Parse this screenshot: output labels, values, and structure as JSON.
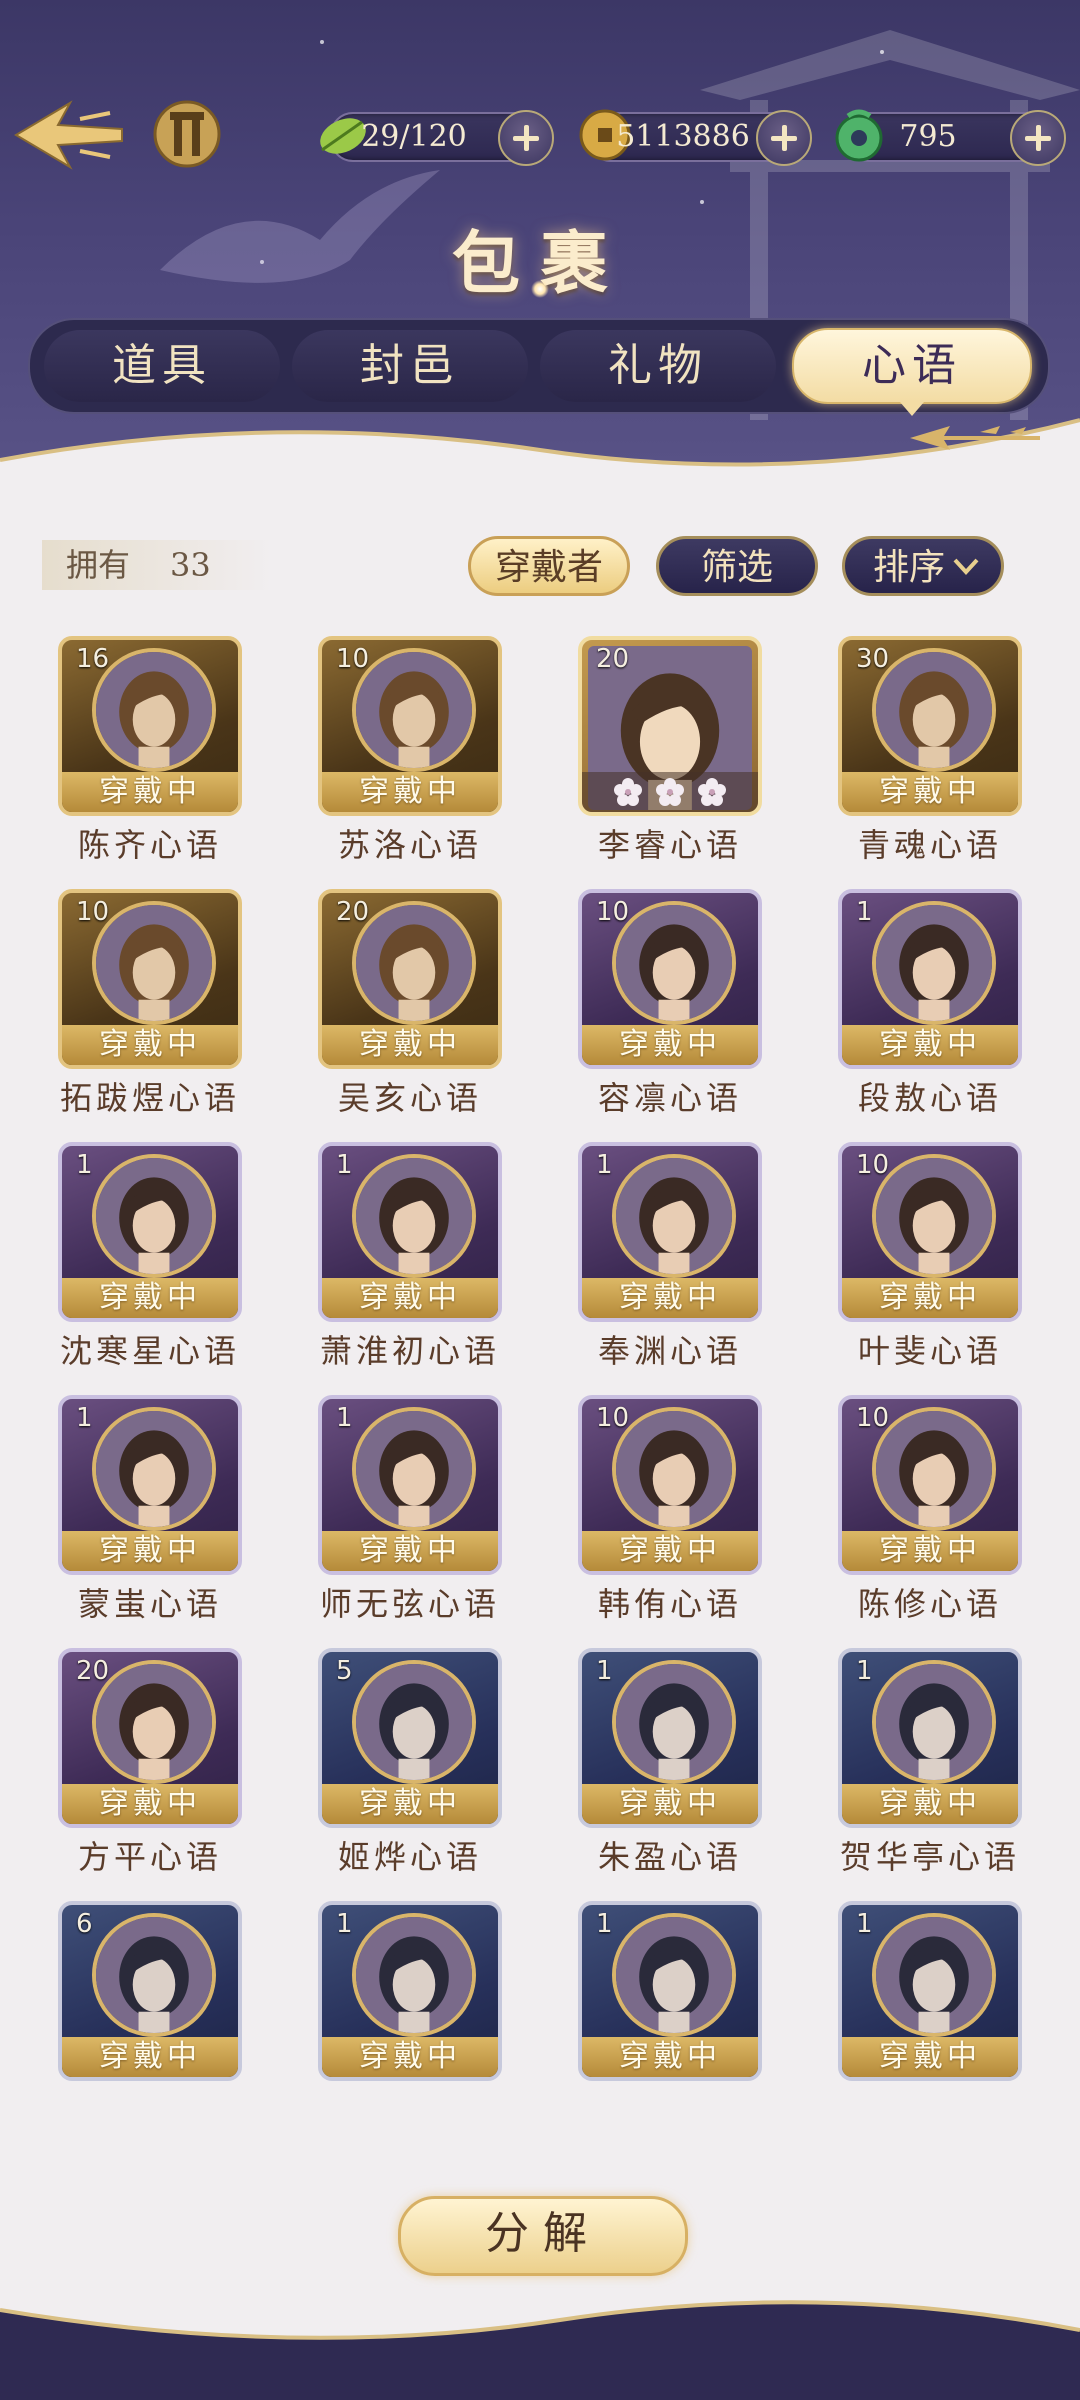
{
  "header": {
    "title": "包裹",
    "resources": [
      {
        "icon": "leaf-stamina-icon",
        "value": "29/120"
      },
      {
        "icon": "coin-icon",
        "value": "5113886"
      },
      {
        "icon": "jade-icon",
        "value": "795"
      }
    ]
  },
  "tabs": [
    {
      "label": "道具",
      "active": false
    },
    {
      "label": "封邑",
      "active": false
    },
    {
      "label": "礼物",
      "active": false
    },
    {
      "label": "心语",
      "active": true
    }
  ],
  "inventory": {
    "owned_label": "拥有",
    "owned_count": "33",
    "wearer_label": "穿戴者",
    "filter_label": "筛选",
    "sort_label": "排序"
  },
  "wearing_label": "穿戴中",
  "cards": [
    {
      "level": "16",
      "name": "陈齐心语",
      "style": "gold",
      "wearing": true
    },
    {
      "level": "10",
      "name": "苏洛心语",
      "style": "gold",
      "wearing": true
    },
    {
      "level": "20",
      "name": "李睿心语",
      "style": "featured",
      "wearing": false
    },
    {
      "level": "30",
      "name": "青魂心语",
      "style": "gold",
      "wearing": true
    },
    {
      "level": "10",
      "name": "拓跋煜心语",
      "style": "gold",
      "wearing": true
    },
    {
      "level": "20",
      "name": "吴亥心语",
      "style": "gold",
      "wearing": true
    },
    {
      "level": "10",
      "name": "容凛心语",
      "style": "purple",
      "wearing": true
    },
    {
      "level": "1",
      "name": "段敖心语",
      "style": "purple",
      "wearing": true
    },
    {
      "level": "1",
      "name": "沈寒星心语",
      "style": "purple",
      "wearing": true
    },
    {
      "level": "1",
      "name": "萧淮初心语",
      "style": "purple",
      "wearing": true
    },
    {
      "level": "1",
      "name": "奉渊心语",
      "style": "purple",
      "wearing": true
    },
    {
      "level": "10",
      "name": "叶斐心语",
      "style": "purple",
      "wearing": true
    },
    {
      "level": "1",
      "name": "蒙蚩心语",
      "style": "purple",
      "wearing": true
    },
    {
      "level": "1",
      "name": "师无弦心语",
      "style": "purple",
      "wearing": true
    },
    {
      "level": "10",
      "name": "韩侑心语",
      "style": "purple",
      "wearing": true
    },
    {
      "level": "10",
      "name": "陈修心语",
      "style": "purple",
      "wearing": true
    },
    {
      "level": "20",
      "name": "方平心语",
      "style": "purple",
      "wearing": true
    },
    {
      "level": "5",
      "name": "姬烨心语",
      "style": "blue",
      "wearing": true
    },
    {
      "level": "1",
      "name": "朱盈心语",
      "style": "blue",
      "wearing": true
    },
    {
      "level": "1",
      "name": "贺华亭心语",
      "style": "blue",
      "wearing": true
    },
    {
      "level": "6",
      "name": "",
      "style": "blue",
      "wearing": true
    },
    {
      "level": "1",
      "name": "",
      "style": "blue",
      "wearing": true
    },
    {
      "level": "1",
      "name": "",
      "style": "blue",
      "wearing": true
    },
    {
      "level": "1",
      "name": "",
      "style": "blue",
      "wearing": true
    }
  ],
  "decompose_label": "分解",
  "colors": {
    "header_bg": "#3c3766",
    "page_bg": "#f1eef0",
    "gold_accent": "#e3c480",
    "name_text": "#5a3c2a"
  }
}
